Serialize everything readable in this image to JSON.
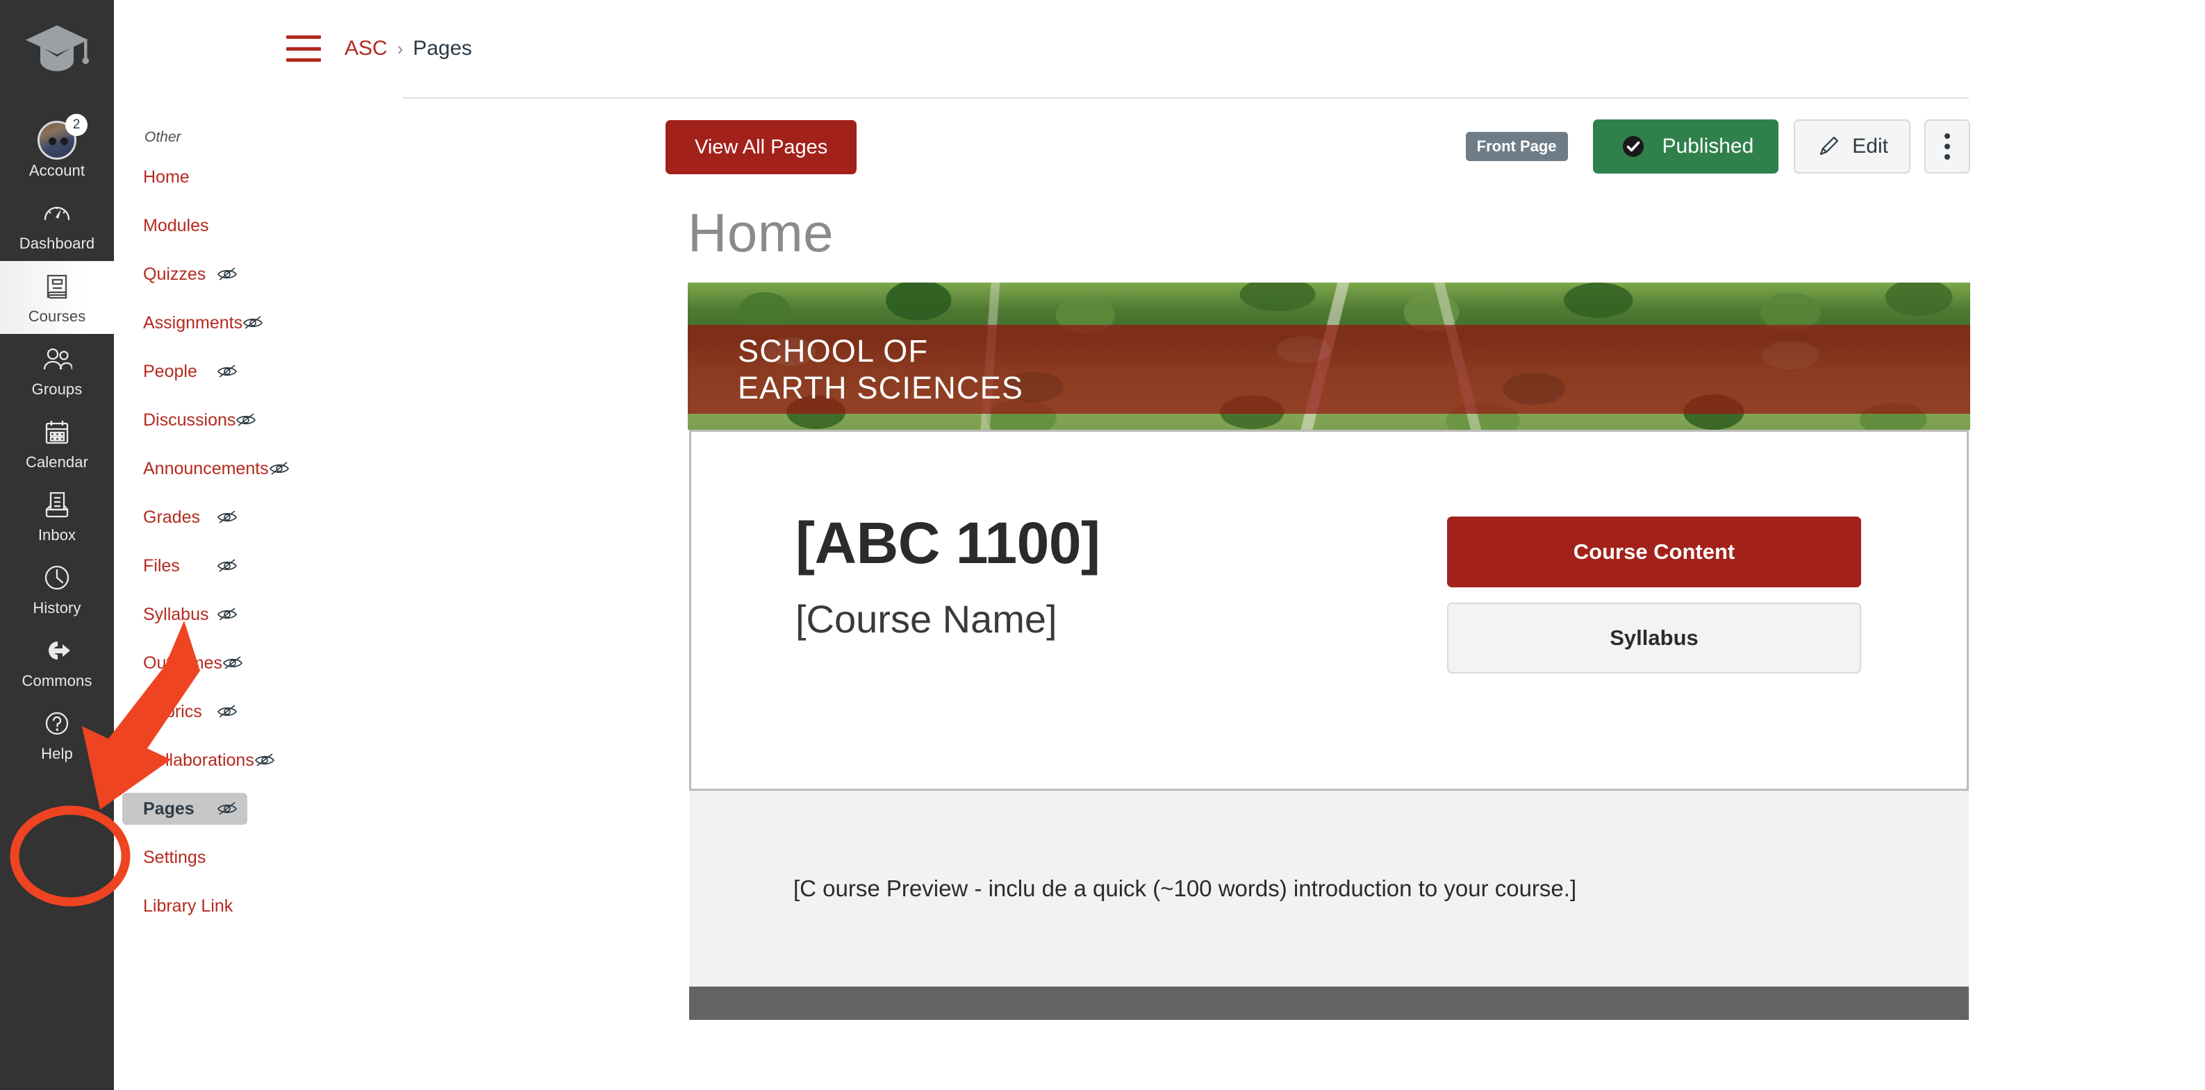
{
  "global_nav": {
    "logo_icon": "graduation-cap-icon",
    "items": [
      {
        "label": "Account",
        "icon": "avatar",
        "badge": "2",
        "active": false
      },
      {
        "label": "Dashboard",
        "icon": "gauge-icon",
        "badge": "",
        "active": false
      },
      {
        "label": "Courses",
        "icon": "book-icon",
        "badge": "",
        "active": true
      },
      {
        "label": "Groups",
        "icon": "people-icon",
        "badge": "",
        "active": false
      },
      {
        "label": "Calendar",
        "icon": "calendar-icon",
        "badge": "",
        "active": false
      },
      {
        "label": "Inbox",
        "icon": "inbox-icon",
        "badge": "",
        "active": false
      },
      {
        "label": "History",
        "icon": "clock-icon",
        "badge": "",
        "active": false
      },
      {
        "label": "Commons",
        "icon": "commons-arrow-icon",
        "badge": "",
        "active": false
      },
      {
        "label": "Help",
        "icon": "question-circle-icon",
        "badge": "",
        "active": false
      }
    ]
  },
  "course_nav": {
    "section_label": "Other",
    "items": [
      {
        "label": "Home",
        "hidden_icon": false,
        "active": false
      },
      {
        "label": "Modules",
        "hidden_icon": false,
        "active": false
      },
      {
        "label": "Quizzes",
        "hidden_icon": true,
        "active": false
      },
      {
        "label": "Assignments",
        "hidden_icon": true,
        "active": false
      },
      {
        "label": "People",
        "hidden_icon": true,
        "active": false
      },
      {
        "label": "Discussions",
        "hidden_icon": true,
        "active": false
      },
      {
        "label": "Announcements",
        "hidden_icon": true,
        "active": false
      },
      {
        "label": "Grades",
        "hidden_icon": true,
        "active": false
      },
      {
        "label": "Files",
        "hidden_icon": true,
        "active": false
      },
      {
        "label": "Syllabus",
        "hidden_icon": true,
        "active": false
      },
      {
        "label": "Outcomes",
        "hidden_icon": true,
        "active": false
      },
      {
        "label": "Rubrics",
        "hidden_icon": true,
        "active": false
      },
      {
        "label": "Collaborations",
        "hidden_icon": true,
        "active": false
      },
      {
        "label": "Pages",
        "hidden_icon": true,
        "active": true
      },
      {
        "label": "Settings",
        "hidden_icon": false,
        "active": false
      },
      {
        "label": "Library Link",
        "hidden_icon": false,
        "active": false
      }
    ]
  },
  "breadcrumb": {
    "menu_icon": "hamburger-icon",
    "course": "ASC",
    "separator": "›",
    "current": "Pages"
  },
  "toolbar": {
    "view_all_pages": "View All Pages",
    "front_page_badge": "Front Page",
    "published_label": "Published",
    "published_icon": "check-circle-icon",
    "edit_label": "Edit",
    "edit_icon": "pencil-icon",
    "more_icon": "kebab-menu-icon"
  },
  "page": {
    "title": "Home",
    "banner": {
      "line1": "SCHOOL OF",
      "line2": "EARTH SCIENCES"
    },
    "card": {
      "course_code": "[ABC 1100]",
      "course_name": "[Course Name]",
      "buttons": [
        {
          "label": "Course Content",
          "style": "primary"
        },
        {
          "label": "Syllabus",
          "style": "secondary"
        }
      ]
    },
    "preview_text": "[C ourse Preview - inclu de a quick (~100 words) introduction to your course.]"
  },
  "annotations": {
    "arrow": {
      "name": "red-arrow-annotation",
      "color": "#EE4422",
      "points_to": "Commons"
    },
    "ellipse": {
      "name": "red-ellipse-annotation",
      "color": "#EE4422",
      "encircles": "Commons"
    }
  },
  "colors": {
    "brand_red": "#A3211B",
    "link_red": "#B42A1F",
    "nav_dark": "#333333",
    "published_green": "#30804C",
    "badge_gray": "#6E7C87",
    "annotation_orange": "#EE4422"
  }
}
